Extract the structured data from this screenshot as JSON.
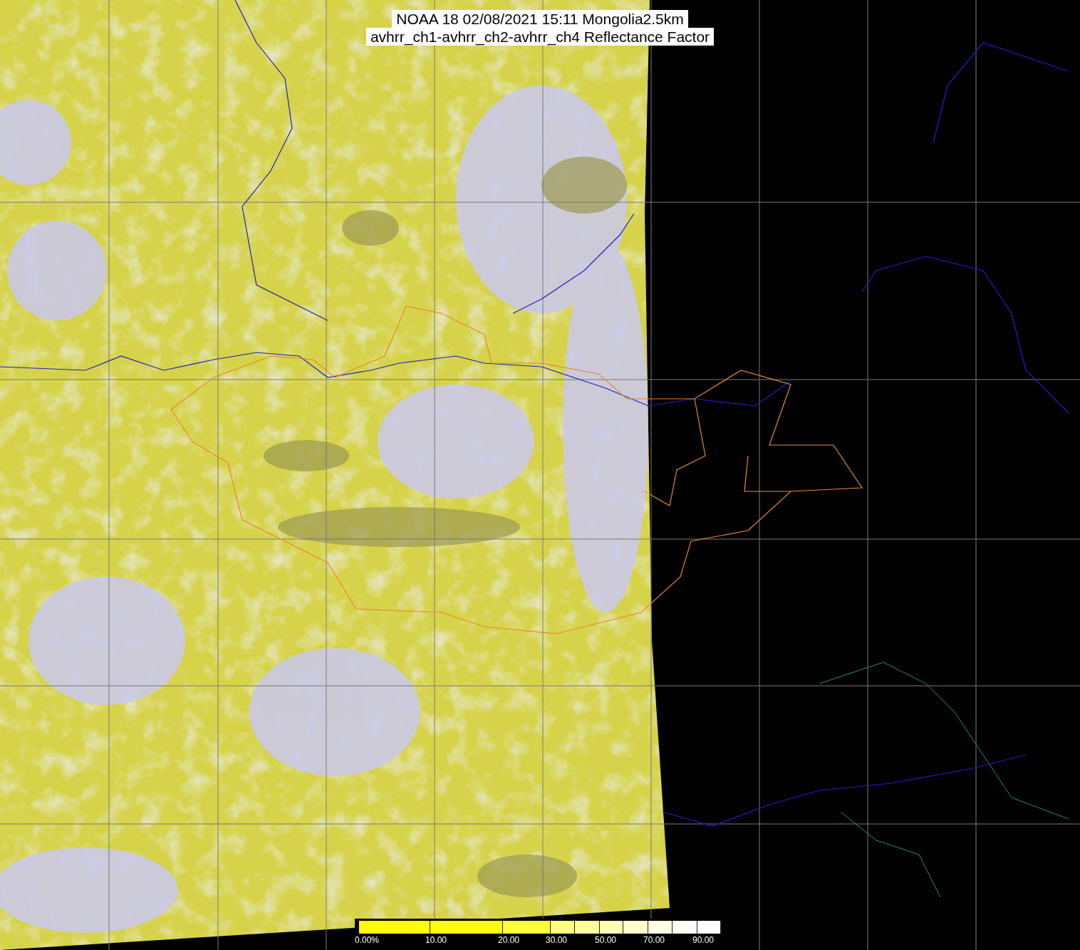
{
  "title": {
    "lines": [
      "NOAA 18 02/08/2021 15:11 Mongolia2.5km",
      "avhrr_ch1-avhrr_ch2-avhrr_ch4 Reflectance Factor"
    ]
  },
  "colorbar": {
    "segments": [
      {
        "color": "#ffff00"
      },
      {
        "color": "#ffff0c"
      },
      {
        "color": "#ffff3c"
      },
      {
        "color": "#ffff80"
      },
      {
        "color": "#ffff9c"
      },
      {
        "color": "#ffffb4"
      },
      {
        "color": "#ffffcc"
      },
      {
        "color": "#ffffe4"
      },
      {
        "color": "#fffff4"
      },
      {
        "color": "#ffffff"
      }
    ],
    "labels": [
      "0.00%",
      "10.00",
      "20.00",
      "30.00",
      "50.00",
      "70.00",
      "90.00"
    ]
  }
}
